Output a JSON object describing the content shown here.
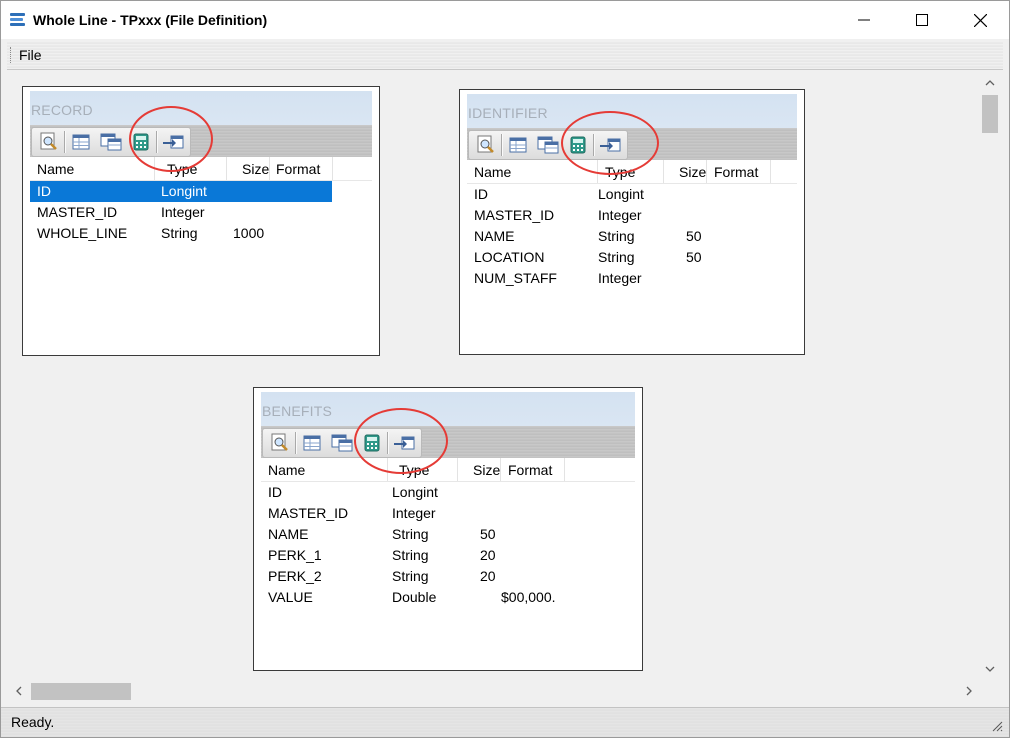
{
  "window": {
    "title": "Whole Line - TPxxx (File Definition)",
    "controls": {
      "minimize": "minimize-icon",
      "maximize": "maximize-icon",
      "close": "close-icon"
    }
  },
  "menubar": {
    "file_label": "File"
  },
  "columns": {
    "name": "Name",
    "type": "Type",
    "size": "Size",
    "format": "Format"
  },
  "panels": {
    "record": {
      "title": "RECORD",
      "rows": [
        {
          "name": "ID",
          "type": "Longint",
          "size": "",
          "format": ""
        },
        {
          "name": "MASTER_ID",
          "type": "Integer",
          "size": "",
          "format": ""
        },
        {
          "name": "WHOLE_LINE",
          "type": "String",
          "size": "1000",
          "format": ""
        }
      ],
      "selected_row": "ID"
    },
    "identifier": {
      "title": "IDENTIFIER",
      "rows": [
        {
          "name": "ID",
          "type": "Longint",
          "size": "",
          "format": ""
        },
        {
          "name": "MASTER_ID",
          "type": "Integer",
          "size": "",
          "format": ""
        },
        {
          "name": "NAME",
          "type": "String",
          "size": "50",
          "format": ""
        },
        {
          "name": "LOCATION",
          "type": "String",
          "size": "50",
          "format": ""
        },
        {
          "name": "NUM_STAFF",
          "type": "Integer",
          "size": "",
          "format": ""
        }
      ]
    },
    "benefits": {
      "title": "BENEFITS",
      "rows": [
        {
          "name": "ID",
          "type": "Longint",
          "size": "",
          "format": ""
        },
        {
          "name": "MASTER_ID",
          "type": "Integer",
          "size": "",
          "format": ""
        },
        {
          "name": "NAME",
          "type": "String",
          "size": "50",
          "format": ""
        },
        {
          "name": "PERK_1",
          "type": "String",
          "size": "20",
          "format": ""
        },
        {
          "name": "PERK_2",
          "type": "String",
          "size": "20",
          "format": ""
        },
        {
          "name": "VALUE",
          "type": "Double",
          "size": "",
          "format": "$00,000."
        }
      ]
    }
  },
  "toolbar_icons": [
    "preview-icon",
    "table-icon",
    "table-copy-icon",
    "calculator-icon",
    "import-icon"
  ],
  "status": {
    "text": "Ready."
  },
  "colors": {
    "selection": "#0a78d7",
    "annotation_circle": "#e53b36",
    "panel_title": "#a7afb9"
  }
}
